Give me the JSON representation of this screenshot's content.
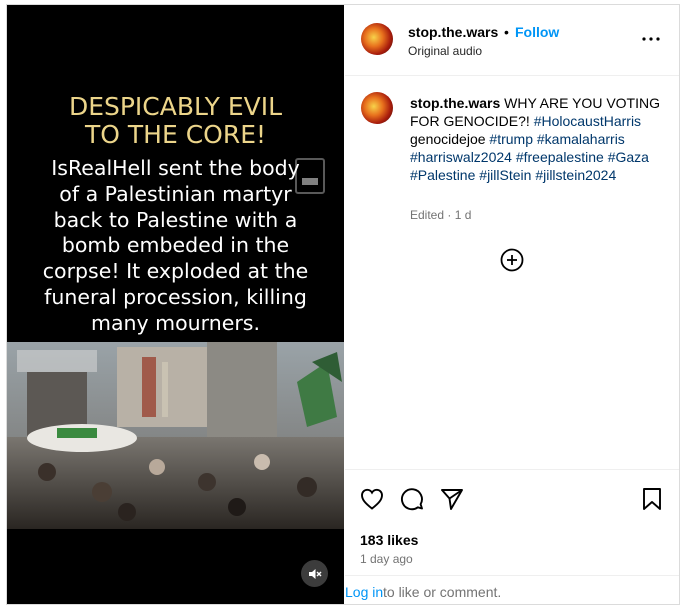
{
  "media": {
    "headline_lines": [
      "DESPICABLY EVIL",
      "TO THE CORE!"
    ],
    "body_lines": [
      "IsRealHell sent the body",
      "of a Palestinian martyr",
      "back  to Palestine with a",
      "bomb embeded in the",
      "corpse! It exploded at the",
      "funeral procession, killing",
      "many mourners."
    ],
    "mute_icon": "speaker-muted-icon"
  },
  "header": {
    "username": "stop.the.wars",
    "separator": "•",
    "follow_label": "Follow",
    "audio_label": "Original audio",
    "more_icon": "more-horizontal-icon"
  },
  "caption": {
    "username": "stop.the.wars",
    "text": "WHY ARE YOU VOTING FOR GENOCIDE?!",
    "segments": [
      {
        "t": "#HolocaustHarris",
        "tag": true
      },
      {
        "t": "genocidejoe",
        "tag": false
      },
      {
        "t": "#trump",
        "tag": true
      },
      {
        "t": "#kamalaharris",
        "tag": true
      },
      {
        "t": "#harriswalz2024",
        "tag": true
      },
      {
        "t": "#freepalestine",
        "tag": true
      },
      {
        "t": "#Gaza",
        "tag": true
      },
      {
        "t": "#Palestine",
        "tag": true
      },
      {
        "t": "#jillStein",
        "tag": true
      },
      {
        "t": "#jillstein2024",
        "tag": true
      }
    ],
    "meta": "Edited · 1 d"
  },
  "actions": {
    "icons": [
      "heart-icon",
      "comment-icon",
      "share-icon",
      "bookmark-icon"
    ],
    "likes": "183 likes",
    "time_ago": "1 day ago",
    "login_label": "Log in",
    "login_suffix": "to like or comment."
  },
  "colors": {
    "accent": "#0095f6",
    "hashtag": "#00376b",
    "headline": "#ecd58a",
    "muted": "#737373"
  }
}
